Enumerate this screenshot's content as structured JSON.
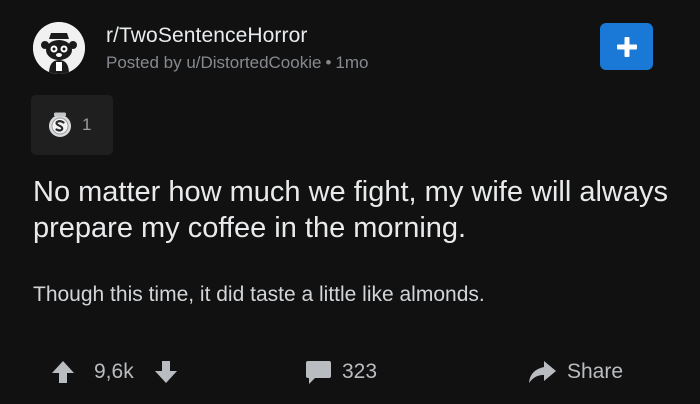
{
  "header": {
    "subreddit": "r/TwoSentenceHorror",
    "posted_by_prefix": "Posted by u/DistortedCookie",
    "dot": "•",
    "age": "1mo"
  },
  "join_button": {
    "icon": "plus-icon"
  },
  "awards": [
    {
      "icon": "silver-award-icon",
      "count": "1"
    }
  ],
  "post": {
    "title": "No matter how much we fight, my wife will always prepare my coffee in the morning.",
    "body": "Though this time, it did taste a little like almonds."
  },
  "actions": {
    "score": "9,6k",
    "comments": "323",
    "share": "Share"
  },
  "colors": {
    "background": "#111111",
    "accent": "#1a78d6",
    "award_bg": "#1f1f20",
    "muted_text": "#868a8e"
  }
}
